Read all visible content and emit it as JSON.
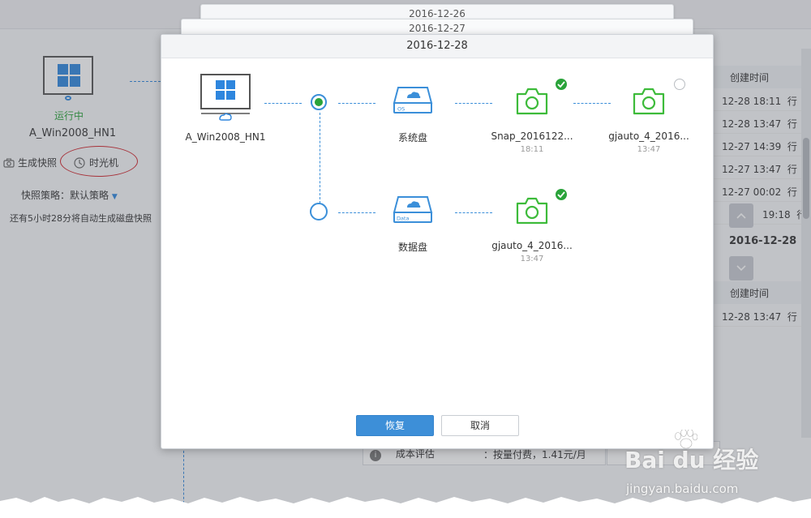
{
  "background": {
    "vm": {
      "status": "运行中",
      "name": "A_Win2008_HN1"
    },
    "actions": {
      "create_snapshot": "生成快照",
      "time_machine": "时光机"
    },
    "policy": {
      "label": "快照策略：默认策略",
      "dropdown_icon": "caret-down-icon"
    },
    "note": "还有5小时28分将自动生成磁盘快照",
    "right_table": {
      "header": "创建时间",
      "rows_top": [
        "12-28 18:11",
        "12-28 13:47",
        "12-27 14:39",
        "12-27 13:47",
        "12-27 00:02",
        "19:18"
      ],
      "row_suffix_top": [
        "行",
        "行",
        "行",
        "行",
        "行",
        "行"
      ],
      "current_date": "2016-12-28",
      "rows_bottom": [
        "12-28 13:47"
      ],
      "row_suffix_bottom": [
        "行"
      ]
    },
    "cost": {
      "label": "成本评估",
      "value": "：按量付费，1.41元/月",
      "info_icon": "info-icon"
    }
  },
  "stack": {
    "tabs": [
      "2016-12-26",
      "2016-12-27"
    ]
  },
  "dialog": {
    "title": "2016-12-28",
    "vm_name": "A_Win2008_HN1",
    "disks": [
      {
        "label": "系统盘",
        "tag": "OS"
      },
      {
        "label": "数据盘",
        "tag": "Data"
      }
    ],
    "snapshots_system": [
      {
        "name": "Snap_2016122...",
        "time": "18:11",
        "checked": true
      },
      {
        "name": "gjauto_4_2016...",
        "time": "13:47",
        "checked": false
      }
    ],
    "snapshots_data": [
      {
        "name": "gjauto_4_2016...",
        "time": "13:47",
        "checked": true
      }
    ],
    "buttons": {
      "restore": "恢复",
      "cancel": "取消"
    }
  },
  "watermark": {
    "logo": "Bai du 经验",
    "url": "jingyan.baidu.com"
  },
  "colors": {
    "accent_blue": "#3b8fd9",
    "success_green": "#2aa33a",
    "primary_button": "#3d8fd8",
    "annotation_red": "#d0232a"
  }
}
